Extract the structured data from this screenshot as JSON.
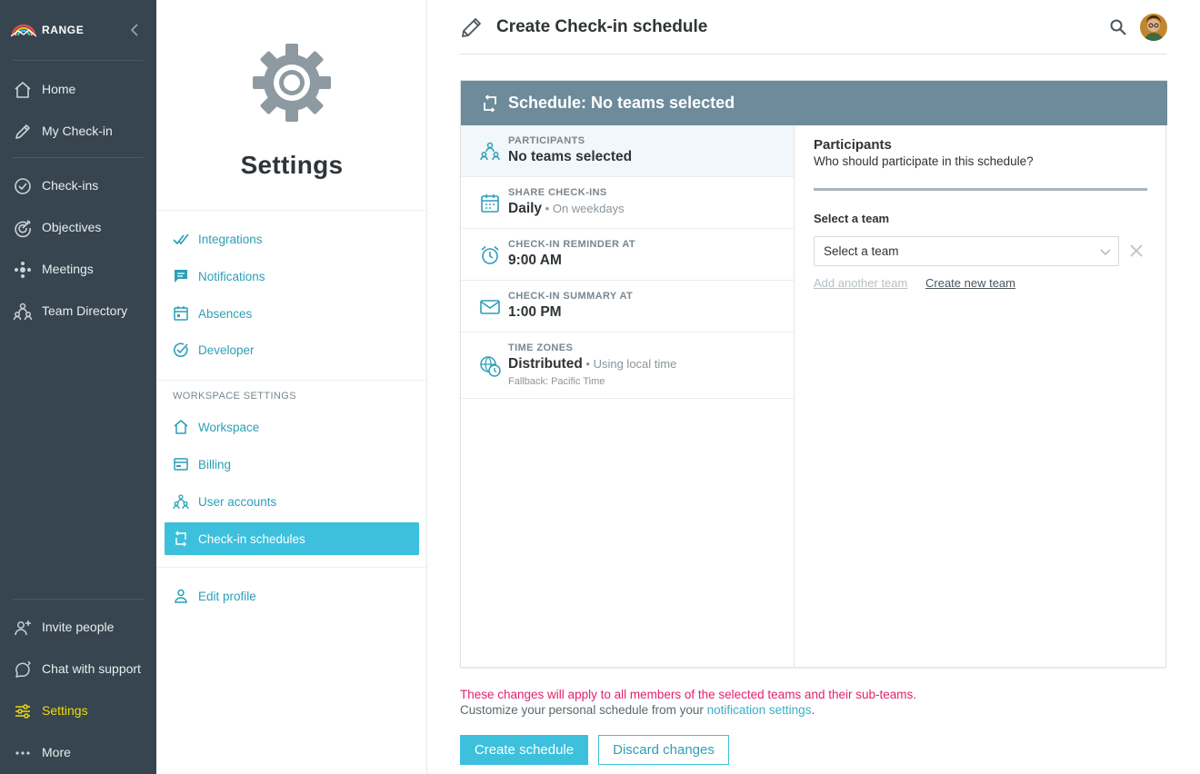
{
  "nav": {
    "brand": "RANGE",
    "items": [
      {
        "label": "Home",
        "icon": "home-icon"
      },
      {
        "label": "My Check-in",
        "icon": "pencil-icon"
      },
      {
        "label": "Check-ins",
        "icon": "check-circle-icon"
      },
      {
        "label": "Objectives",
        "icon": "target-icon"
      },
      {
        "label": "Meetings",
        "icon": "meetings-icon"
      },
      {
        "label": "Team Directory",
        "icon": "team-icon"
      }
    ],
    "bottom": [
      {
        "label": "Invite people",
        "icon": "invite-person-icon"
      },
      {
        "label": "Chat with support",
        "icon": "chat-icon"
      },
      {
        "label": "Settings",
        "icon": "sliders-icon",
        "active": true
      },
      {
        "label": "More",
        "icon": "more-dots-icon"
      }
    ],
    "active_color": "#f2d90e"
  },
  "settings": {
    "title": "Settings",
    "items": [
      {
        "label": "Integrations",
        "icon": "integrations-icon"
      },
      {
        "label": "Notifications",
        "icon": "notifications-icon"
      },
      {
        "label": "Absences",
        "icon": "calendar-icon"
      },
      {
        "label": "Developer",
        "icon": "developer-icon"
      }
    ],
    "workspace_heading": "WORKSPACE SETTINGS",
    "workspace_items": [
      {
        "label": "Workspace",
        "icon": "home-icon"
      },
      {
        "label": "Billing",
        "icon": "billing-icon"
      },
      {
        "label": "User accounts",
        "icon": "team-icon"
      },
      {
        "label": "Check-in schedules",
        "icon": "schedule-icon",
        "active": true
      }
    ],
    "profile_item": {
      "label": "Edit profile",
      "icon": "person-icon"
    }
  },
  "main": {
    "title": "Create Check-in schedule",
    "banner": "Schedule: No teams selected",
    "steps": [
      {
        "caption": "PARTICIPANTS",
        "value": "No teams selected",
        "sub": "",
        "note": "",
        "icon": "participants-icon"
      },
      {
        "caption": "SHARE CHECK-INS",
        "value": "Daily",
        "sub": " • On weekdays",
        "note": "",
        "icon": "calendar-icon"
      },
      {
        "caption": "CHECK-IN REMINDER AT",
        "value": "9:00 AM",
        "sub": "",
        "note": "",
        "icon": "alarm-icon"
      },
      {
        "caption": "CHECK-IN SUMMARY AT",
        "value": "1:00 PM",
        "sub": "",
        "note": "",
        "icon": "envelope-icon"
      },
      {
        "caption": "TIME ZONES",
        "value": "Distributed",
        "sub": " • Using local time",
        "note": "Fallback: Pacific Time",
        "icon": "timezone-icon"
      }
    ],
    "pane": {
      "title": "Participants",
      "subtitle": "Who should participate in this schedule?",
      "select_label": "Select a team",
      "select_value": "Select a team",
      "add_link": "Add another team",
      "new_link": "Create new team"
    },
    "message_warning": "These changes will apply to all members of the selected teams and their sub-teams.",
    "message_info": "Customize your personal schedule from your ",
    "message_link": "notification settings",
    "message_end": ".",
    "create_button": "Create schedule",
    "discard_button": "Discard changes"
  },
  "colors": {
    "nav_bg": "#36454f",
    "accent": "#3cc0dc",
    "banner": "#6d8b9b",
    "warning": "#e2216d"
  }
}
